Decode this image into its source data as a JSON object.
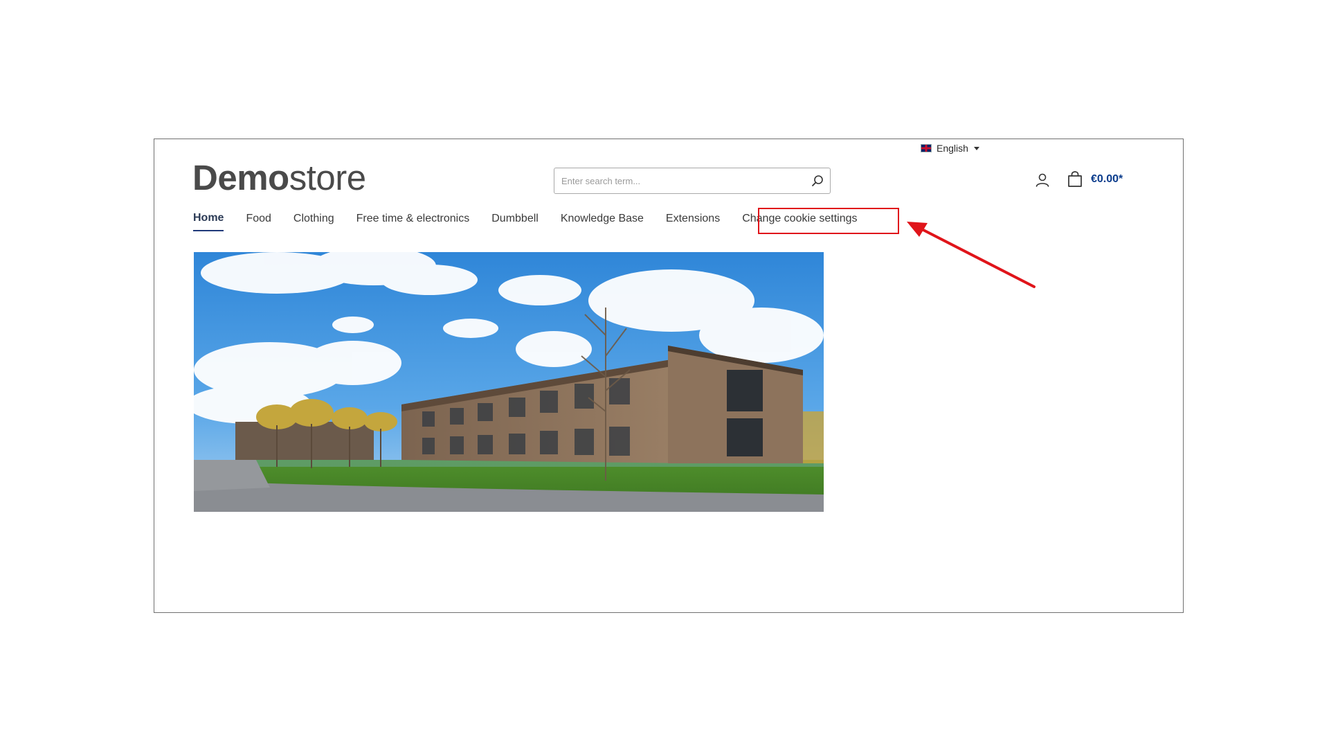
{
  "language": {
    "label": "English",
    "flag_icon": "uk-flag-icon"
  },
  "logo": {
    "bold": "Demo",
    "light": "store"
  },
  "search": {
    "placeholder": "Enter search term..."
  },
  "cart": {
    "total": "€0.00*"
  },
  "nav": {
    "items": [
      {
        "label": "Home",
        "active": true
      },
      {
        "label": "Food"
      },
      {
        "label": "Clothing"
      },
      {
        "label": "Free time & electronics"
      },
      {
        "label": "Dumbbell"
      },
      {
        "label": "Knowledge Base"
      },
      {
        "label": "Extensions"
      },
      {
        "label": "Change cookie settings",
        "highlighted": true
      }
    ]
  },
  "colors": {
    "accent": "#0b3c8c",
    "annotation": "#e0141a"
  }
}
